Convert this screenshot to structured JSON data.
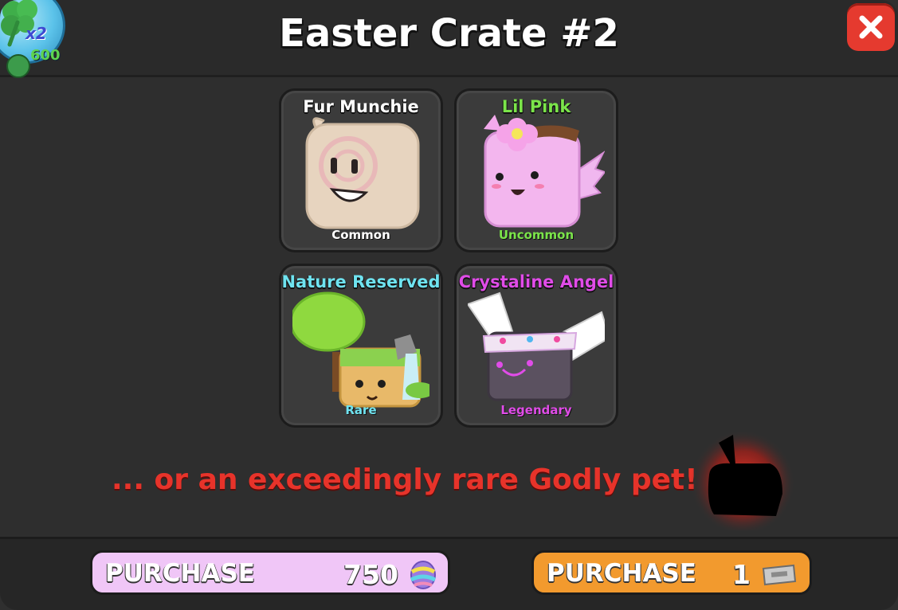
{
  "header": {
    "title": "Easter Crate #2",
    "close_icon": "close-icon"
  },
  "badge": {
    "multiplier": "x2",
    "coin_count": "600",
    "icon": "clover-icon"
  },
  "pets": [
    {
      "name": "Fur Munchie",
      "rarity": "Common",
      "name_color": "#ffffff",
      "rarity_color": "#ffffff"
    },
    {
      "name": "Lil Pink",
      "rarity": "Uncommon",
      "name_color": "#7be44a",
      "rarity_color": "#7be44a"
    },
    {
      "name": "Nature Reserved",
      "rarity": "Rare",
      "name_color": "#6fe3f0",
      "rarity_color": "#6fe3f0"
    },
    {
      "name": "Crystaline Angel",
      "rarity": "Legendary",
      "name_color": "#e04ce8",
      "rarity_color": "#e04ce8"
    }
  ],
  "godly_text": "... or an exceedingly rare Godly pet!",
  "footer": {
    "eggs_button": {
      "label": "PURCHASE",
      "amount": "750",
      "icon": "easter-egg-icon"
    },
    "ticket_button": {
      "label": "PURCHASE",
      "amount": "1",
      "icon": "ticket-icon"
    }
  },
  "colors": {
    "close": "#e53a2f",
    "godly": "#e7332a",
    "eggs_button": "#f0c6f7",
    "ticket_button": "#f29a2e"
  }
}
